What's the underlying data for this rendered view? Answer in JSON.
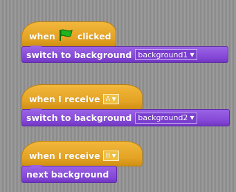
{
  "scripts": [
    {
      "hat": {
        "prefix": "when",
        "suffix": "clicked",
        "flag_icon": "green-flag-icon"
      },
      "command": {
        "label": "switch to background",
        "value": "background1"
      }
    },
    {
      "hat": {
        "label": "when I receive",
        "message": "A"
      },
      "command": {
        "label": "switch to background",
        "value": "background2"
      }
    },
    {
      "hat": {
        "label": "when I receive",
        "message": "B"
      },
      "command": {
        "label": "next background"
      }
    }
  ],
  "colors": {
    "control": "#e3a223",
    "looks": "#8447d6",
    "flag": "#1fb51f"
  },
  "dropdown_arrow": "▼"
}
